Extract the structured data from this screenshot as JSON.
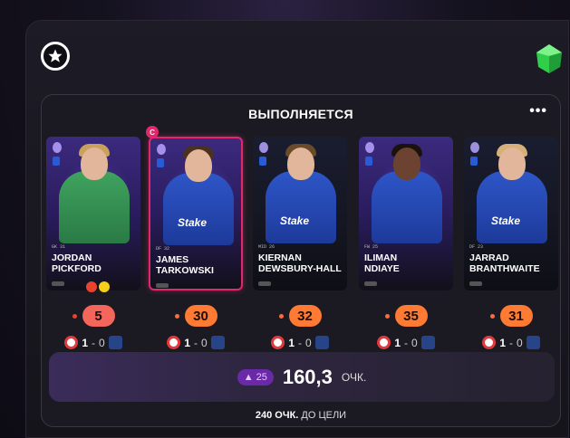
{
  "header": {
    "status": "ВЫПОЛНЯЕТСЯ",
    "more_icon": "more-dots-icon"
  },
  "players": [
    {
      "first_name": "JORDAN",
      "last_name": "PICKFORD",
      "position": "GK",
      "number": "31",
      "points": "5",
      "points_color": "#f4665c",
      "home_score": "1",
      "away_score": "0",
      "captain": false,
      "tags": [
        "red-card",
        "yellow-card"
      ]
    },
    {
      "first_name": "JAMES",
      "last_name": "TARKOWSKI",
      "position": "DF",
      "number": "32",
      "points": "30",
      "points_color": "#ff7a33",
      "home_score": "1",
      "away_score": "0",
      "captain": true,
      "captain_label": "C"
    },
    {
      "first_name": "KIERNAN",
      "last_name": "DEWSBURY-HALL",
      "position": "MID",
      "number": "26",
      "points": "32",
      "points_color": "#ff7a33",
      "home_score": "1",
      "away_score": "0",
      "captain": false
    },
    {
      "first_name": "ILIMAN",
      "last_name": "NDIAYE",
      "position": "FW",
      "number": "25",
      "points": "35",
      "points_color": "#ff7a33",
      "home_score": "1",
      "away_score": "0",
      "captain": false
    },
    {
      "first_name": "JARRAD",
      "last_name": "BRANTHWAITE",
      "position": "DF",
      "number": "23",
      "points": "31",
      "points_color": "#ff7a33",
      "home_score": "1",
      "away_score": "0",
      "captain": false
    }
  ],
  "total": {
    "delta": "25",
    "value": "160,3",
    "unit": "ОЧК."
  },
  "goal": {
    "points": "240 ОЧК.",
    "suffix": "ДО ЦЕЛИ"
  },
  "jersey_sponsor": "Stake",
  "colors": {
    "accent_orange": "#ff7a33",
    "accent_red": "#f4665c",
    "captain_pink": "#e0286b",
    "delta_purple": "#6a2aa8"
  }
}
